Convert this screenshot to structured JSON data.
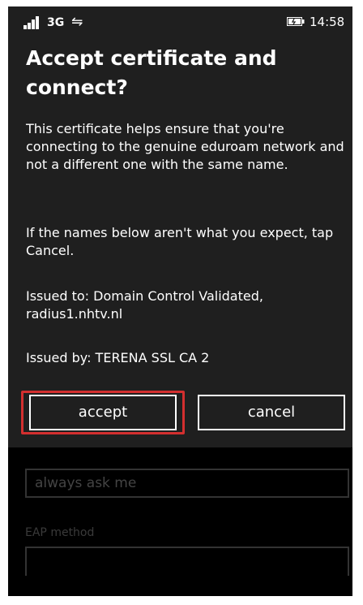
{
  "status_bar": {
    "network": "3G",
    "time": "14:58",
    "signal_icon": "signal-bars-icon",
    "sync_icon": "data-sync-icon",
    "battery_icon": "battery-charging-icon"
  },
  "dialog": {
    "title": "Accept certificate and connect?",
    "paragraphs": [
      "This certificate helps ensure that you're connecting to the genuine eduroam network and not a different one with the same name.",
      "If the names below aren't what you expect, tap Cancel.",
      "Issued to: Domain Control Validated, radius1.nhtv.nl",
      "Issued by: TERENA SSL CA 2"
    ],
    "accept_label": "accept",
    "cancel_label": "cancel",
    "highlight_color": "#d32f2f"
  },
  "background_form": {
    "field_value": "always ask me",
    "eap_label": "EAP method"
  }
}
